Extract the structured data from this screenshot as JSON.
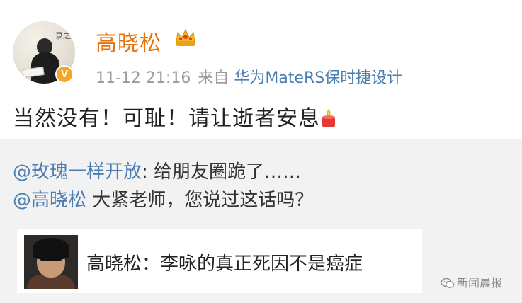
{
  "post": {
    "username": "高晓松",
    "timestamp": "11-12 21:16",
    "source_prefix": "来自",
    "source": "华为MateRS保时捷设计",
    "content": "当然没有！可耻！请让逝者安息",
    "avatar_calligraphy": "录之"
  },
  "repost": {
    "line1_mention": "@玫瑰一样开放",
    "line1_text": ": 给朋友圈跪了……",
    "line2_mention": "@高晓松",
    "line2_text": " 大紧老师，您说过这话吗？",
    "card_title": "高晓松：李咏的真正死因不是癌症"
  },
  "watermark": {
    "text": "新闻晨报"
  },
  "icons": {
    "verified": "verified-v-badge",
    "crown": "crown-icon",
    "candle": "candle-emoji",
    "watermark_logo": "wechat-icon"
  },
  "colors": {
    "username": "#e8720c",
    "link": "#4a7eb3",
    "meta": "#9a9a9a",
    "repost_bg": "#f2f2f2"
  }
}
